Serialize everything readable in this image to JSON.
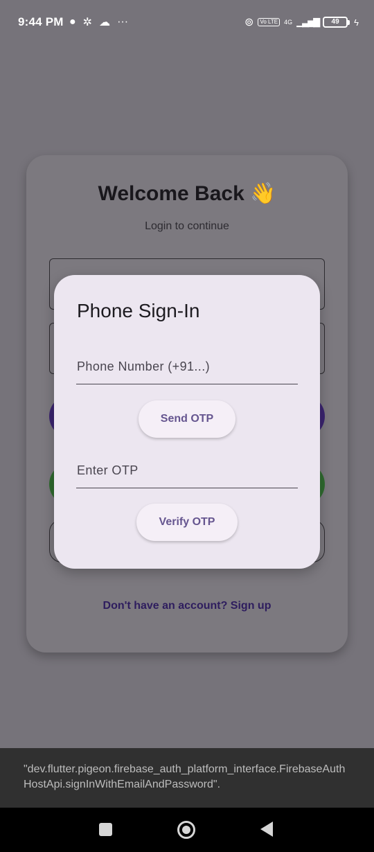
{
  "status_bar": {
    "time": "9:44 PM",
    "left_icons": [
      "chat-bubble-icon",
      "settings-gear-icon",
      "cloud-icon",
      "more-dots-icon"
    ],
    "network_label": "4G",
    "volte_label": "Vo LTE",
    "battery_level": 49,
    "battery_text": "49",
    "charging": true
  },
  "login_card": {
    "title": "Welcome Back 👋",
    "subtitle": "Login to continue",
    "signup_link": "Don't have an account? Sign up",
    "colors": {
      "primary_button": "#3b2470",
      "google_button": "#2f6b2f"
    }
  },
  "dialog": {
    "title": "Phone Sign-In",
    "phone_placeholder": "Phone Number (+91...)",
    "phone_value": "",
    "send_otp_label": "Send OTP",
    "otp_placeholder": "Enter OTP",
    "otp_value": "",
    "verify_otp_label": "Verify OTP"
  },
  "toast": {
    "message": "\"dev.flutter.pigeon.firebase_auth_platform_interface.FirebaseAuthHostApi.signInWithEmailAndPassword\"."
  },
  "nav_bar": {
    "icons": [
      "recents-square-icon",
      "home-circle-icon",
      "back-triangle-icon"
    ]
  }
}
